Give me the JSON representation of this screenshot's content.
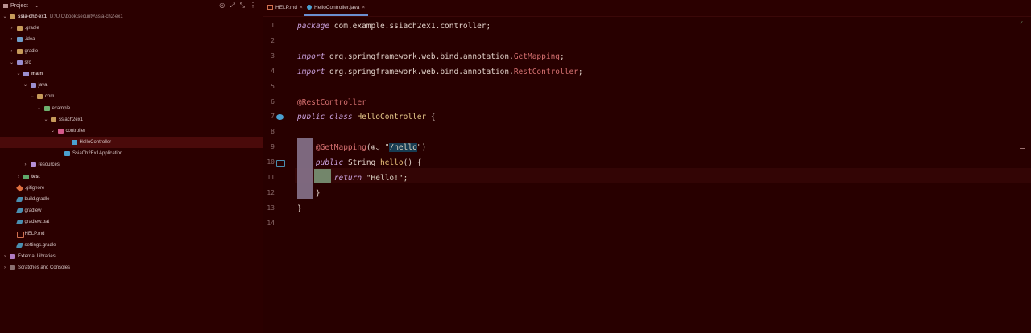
{
  "project_panel": {
    "title": "Project",
    "title_chevron": "chevron-down-icon",
    "header_icons": [
      "target-icon",
      "expand-icon",
      "collapse-icon",
      "more-icon"
    ],
    "tree": [
      {
        "label": "ssia-ch2-ex1",
        "path": "D:\\U.C\\book\\security\\ssia-ch2-ex1",
        "indent": 0,
        "arrow": "down",
        "icon": "folder",
        "bold": true
      },
      {
        "label": ".gradle",
        "indent": 1,
        "arrow": "right",
        "icon": "folder"
      },
      {
        "label": ".idea",
        "indent": 1,
        "arrow": "right",
        "icon": "folder-blue"
      },
      {
        "label": "gradle",
        "indent": 1,
        "arrow": "right",
        "icon": "folder"
      },
      {
        "label": "src",
        "indent": 1,
        "arrow": "down",
        "icon": "folder-src"
      },
      {
        "label": "main",
        "indent": 2,
        "arrow": "down",
        "icon": "folder-src",
        "bold": true
      },
      {
        "label": "java",
        "indent": 3,
        "arrow": "down",
        "icon": "folder-src"
      },
      {
        "label": "com",
        "indent": 4,
        "arrow": "down",
        "icon": "folder"
      },
      {
        "label": "example",
        "indent": 5,
        "arrow": "down",
        "icon": "folder-green"
      },
      {
        "label": "ssiach2ex1",
        "indent": 6,
        "arrow": "down",
        "icon": "folder"
      },
      {
        "label": "controller",
        "indent": 7,
        "arrow": "down",
        "icon": "folder-pink"
      },
      {
        "label": "HelloController",
        "indent": 9,
        "arrow": "",
        "icon": "class",
        "selected": true
      },
      {
        "label": "SsiaCh2Ex1Application",
        "indent": 8,
        "arrow": "",
        "icon": "class"
      },
      {
        "label": "resources",
        "indent": 3,
        "arrow": "right",
        "icon": "res"
      },
      {
        "label": "test",
        "indent": 2,
        "arrow": "right",
        "icon": "folder-test",
        "bold": true
      },
      {
        "label": ".gitignore",
        "indent": 1,
        "arrow": "",
        "icon": "git"
      },
      {
        "label": "build.gradle",
        "indent": 1,
        "arrow": "",
        "icon": "gradle"
      },
      {
        "label": "gradlew",
        "indent": 1,
        "arrow": "",
        "icon": "gradle"
      },
      {
        "label": "gradlew.bat",
        "indent": 1,
        "arrow": "",
        "icon": "gradle"
      },
      {
        "label": "HELP.md",
        "indent": 1,
        "arrow": "",
        "icon": "md"
      },
      {
        "label": "settings.gradle",
        "indent": 1,
        "arrow": "",
        "icon": "gradle"
      },
      {
        "label": "External Libraries",
        "indent": 0,
        "arrow": "right",
        "icon": "lib"
      },
      {
        "label": "Scratches and Consoles",
        "indent": 0,
        "arrow": "right",
        "icon": "scratch"
      }
    ]
  },
  "tabs": [
    {
      "label": "HELP.md",
      "icon": "md-icon",
      "close": "×",
      "active": false
    },
    {
      "label": "HelloController.java",
      "icon": "class-icon",
      "close": "×",
      "active": true
    }
  ],
  "editor": {
    "line_numbers": [
      "1",
      "2",
      "3",
      "4",
      "5",
      "6",
      "7",
      "8",
      "9",
      "10",
      "11",
      "12",
      "13",
      "14"
    ],
    "lines": [
      {
        "n": 1,
        "tokens": [
          {
            "t": "package",
            "c": "kw"
          },
          {
            "t": " com.example.ssiach2ex1.controller;",
            "c": "plain"
          }
        ]
      },
      {
        "n": 2,
        "tokens": []
      },
      {
        "n": 3,
        "tokens": [
          {
            "t": "import",
            "c": "kw"
          },
          {
            "t": " org.springframework.web.bind.annotation.",
            "c": "plain"
          },
          {
            "t": "GetMapping",
            "c": "ann"
          },
          {
            "t": ";",
            "c": "plain"
          }
        ]
      },
      {
        "n": 4,
        "tokens": [
          {
            "t": "import",
            "c": "kw"
          },
          {
            "t": " org.springframework.web.bind.annotation.",
            "c": "plain"
          },
          {
            "t": "RestController",
            "c": "ann"
          },
          {
            "t": ";",
            "c": "plain"
          }
        ]
      },
      {
        "n": 5,
        "tokens": []
      },
      {
        "n": 6,
        "tokens": [
          {
            "t": "@RestController",
            "c": "ann"
          }
        ]
      },
      {
        "n": 7,
        "tokens": [
          {
            "t": "public class",
            "c": "kw"
          },
          {
            "t": " ",
            "c": "plain"
          },
          {
            "t": "HelloController",
            "c": "cls"
          },
          {
            "t": " {",
            "c": "plain"
          }
        ]
      },
      {
        "n": 8,
        "tokens": []
      },
      {
        "n": 9,
        "tokens": [
          {
            "t": "    ",
            "c": "plain"
          },
          {
            "t": "@GetMapping",
            "c": "ann"
          },
          {
            "t": "(",
            "c": "plain"
          },
          {
            "t": "⊕",
            "c": "plain"
          },
          {
            "t": "⌄ ",
            "c": "plain"
          },
          {
            "t": "\"",
            "c": "str"
          },
          {
            "t": "/hello",
            "c": "hl"
          },
          {
            "t": "\")",
            "c": "str"
          }
        ]
      },
      {
        "n": 10,
        "tokens": [
          {
            "t": "    ",
            "c": "plain"
          },
          {
            "t": "public",
            "c": "kw"
          },
          {
            "t": " String ",
            "c": "plain"
          },
          {
            "t": "hello",
            "c": "fn"
          },
          {
            "t": "() {",
            "c": "plain"
          }
        ]
      },
      {
        "n": 11,
        "tokens": [
          {
            "t": "        ",
            "c": "plain"
          },
          {
            "t": "return",
            "c": "kw"
          },
          {
            "t": " \"Hello!\";",
            "c": "str"
          },
          {
            "t": "",
            "c": "caret"
          }
        ]
      },
      {
        "n": 12,
        "tokens": [
          {
            "t": "    }",
            "c": "plain"
          }
        ]
      },
      {
        "n": 13,
        "tokens": [
          {
            "t": "}",
            "c": "plain"
          }
        ]
      },
      {
        "n": 14,
        "tokens": []
      }
    ],
    "gutter_icons": {
      "7": "bean-icon",
      "10": "api-icon"
    },
    "status_mark": "✓"
  }
}
